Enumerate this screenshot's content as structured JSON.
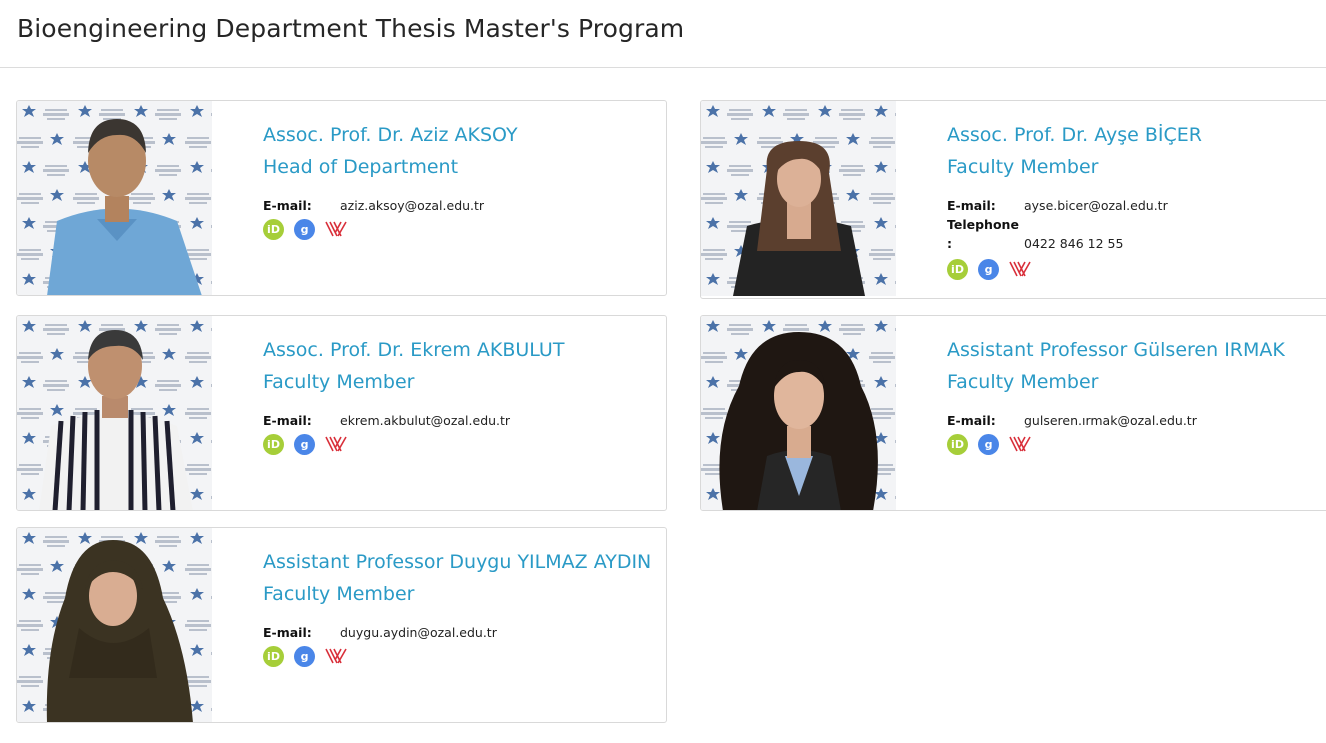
{
  "page": {
    "title": "Bioengineering Department Thesis Master's Program"
  },
  "colors": {
    "accent": "#2a9ac6",
    "orcid": "#a6ce39",
    "scholar": "#4a86e8",
    "yok": "#d9303b"
  },
  "icons": [
    "orcid-icon",
    "google-scholar-icon",
    "yok-icon"
  ],
  "faculty": [
    {
      "name": "Assoc. Prof. Dr. Aziz AKSOY",
      "role": "Head of Department",
      "email_label": "E-mail:",
      "email": "aziz.aksoy@ozal.edu.tr"
    },
    {
      "name": "Assoc. Prof. Dr. Ayşe BİÇER",
      "role": "Faculty Member",
      "email_label": "E-mail:",
      "email": "ayse.bicer@ozal.edu.tr",
      "telephone_label": "Telephone",
      "telephone_colon": ":",
      "telephone": "0422 846 12 55"
    },
    {
      "name": "Assoc. Prof. Dr. Ekrem AKBULUT",
      "role": "Faculty Member",
      "email_label": "E-mail:",
      "email": "ekrem.akbulut@ozal.edu.tr"
    },
    {
      "name": "Assistant Professor Gülseren IRMAK",
      "role": "Faculty Member",
      "email_label": "E-mail:",
      "email": "gulseren.ırmak@ozal.edu.tr"
    },
    {
      "name": "Assistant Professor Duygu YILMAZ AYDIN",
      "role": "Faculty Member",
      "email_label": "E-mail:",
      "email": "duygu.aydin@ozal.edu.tr"
    }
  ]
}
